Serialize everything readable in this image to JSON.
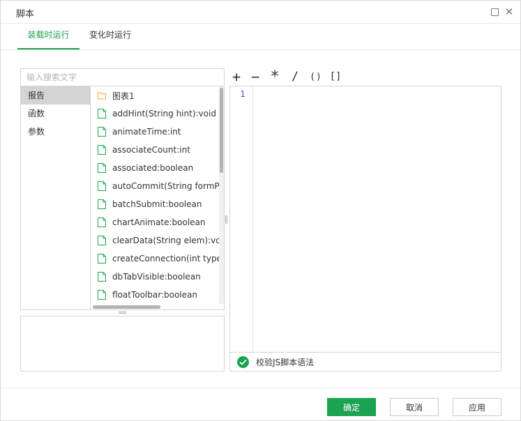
{
  "window": {
    "title": "脚本"
  },
  "tabs": [
    {
      "label": "装载时运行",
      "active": true
    },
    {
      "label": "变化时运行",
      "active": false
    }
  ],
  "search": {
    "placeholder": "输入搜索文字",
    "value": ""
  },
  "categories": [
    {
      "label": "报告",
      "selected": true
    },
    {
      "label": "函数",
      "selected": false
    },
    {
      "label": "参数",
      "selected": false
    }
  ],
  "members": [
    {
      "label": "图表1",
      "icon": "folder-icon"
    },
    {
      "label": "addHint(String hint):void",
      "icon": "file-icon"
    },
    {
      "label": "animateTime:int",
      "icon": "file-icon"
    },
    {
      "label": "associateCount:int",
      "icon": "file-icon"
    },
    {
      "label": "associated:boolean",
      "icon": "file-icon"
    },
    {
      "label": "autoCommit(String formParm",
      "icon": "file-icon"
    },
    {
      "label": "batchSubmit:boolean",
      "icon": "file-icon"
    },
    {
      "label": "chartAnimate:boolean",
      "icon": "file-icon"
    },
    {
      "label": "clearData(String elem):void",
      "icon": "file-icon"
    },
    {
      "label": "createConnection(int type,Str",
      "icon": "file-icon"
    },
    {
      "label": "dbTabVisible:boolean",
      "icon": "file-icon"
    },
    {
      "label": "floatToolbar:boolean",
      "icon": "file-icon"
    }
  ],
  "operators": {
    "plus": "+",
    "minus": "−",
    "times": "*",
    "divide": "/",
    "paren": "()",
    "bracket": "[]"
  },
  "editor": {
    "line_numbers": [
      "1"
    ],
    "code": ""
  },
  "status": {
    "label": "校验JS脚本语法"
  },
  "buttons": {
    "ok": "确定",
    "cancel": "取消",
    "apply": "应用"
  },
  "colors": {
    "accent": "#1aa350",
    "folder": "#f0a830",
    "file": "#1aa350",
    "line_number": "#2b56c8"
  }
}
